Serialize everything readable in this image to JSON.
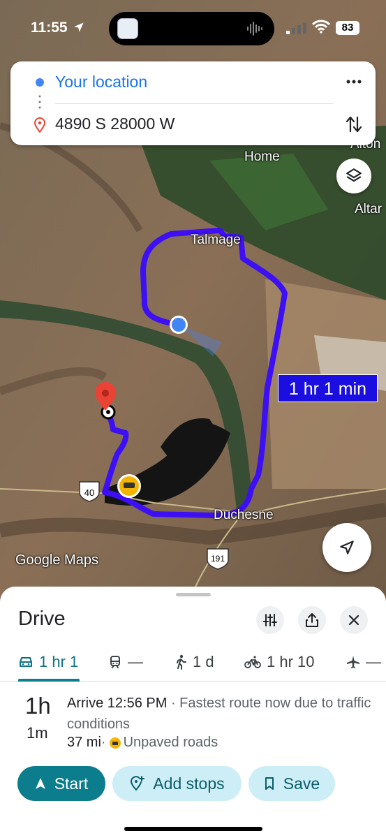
{
  "status_bar": {
    "time": "11:55",
    "battery": "83"
  },
  "directions": {
    "origin": "Your location",
    "destination": "4890 S 28000 W"
  },
  "map": {
    "labels": {
      "home": "Home",
      "alton": "Alton",
      "altamont": "Altar",
      "talmage": "Talmage",
      "duchesne": "Duchesne",
      "us40": "40",
      "us191": "191"
    },
    "route_time_label": "1 hr 1 min",
    "logo": "Google Maps",
    "route_color": "#3d0ff5"
  },
  "sheet": {
    "title": "Drive",
    "modes": [
      {
        "name": "drive",
        "label": "1 hr 1"
      },
      {
        "name": "transit",
        "label": "—"
      },
      {
        "name": "walk",
        "label": "1 d"
      },
      {
        "name": "bike",
        "label": "1 hr 10"
      },
      {
        "name": "flight",
        "label": "—"
      }
    ],
    "duration_hours": "1h",
    "duration_minutes": "1m",
    "arrive": "Arrive 12:56 PM",
    "arrive_note": " · Fastest route now due to traffic conditions",
    "distance": "37 mi",
    "separator": " · ",
    "road_note": "Unpaved roads",
    "buttons": {
      "start": "Start",
      "add_stops": "Add stops",
      "save": "Save"
    }
  },
  "colors": {
    "accent": "#0b7d8c",
    "route": "#3d0ff5",
    "pin": "#ea4335",
    "location": "#4285f4"
  }
}
